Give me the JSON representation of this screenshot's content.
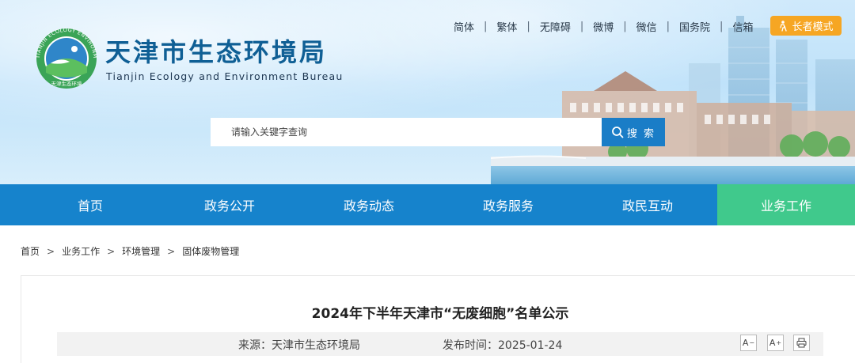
{
  "header": {
    "title": "天津市生态环境局",
    "subtitle": "Tianjin Ecology and Environment Bureau",
    "logo_ring_text": "TIANJIN ECOLOGY ENVIRONMENT",
    "logo_bottom_text": "天津生态环境",
    "top_links": [
      "简体",
      "繁体",
      "无障碍",
      "微博",
      "微信",
      "国务院",
      "信箱"
    ],
    "elder_mode": "长者模式",
    "search": {
      "placeholder": "请输入关键字查询",
      "button": "搜 索"
    }
  },
  "nav": [
    {
      "label": "首页",
      "active": false
    },
    {
      "label": "政务公开",
      "active": false
    },
    {
      "label": "政务动态",
      "active": false
    },
    {
      "label": "政务服务",
      "active": false
    },
    {
      "label": "政民互动",
      "active": false
    },
    {
      "label": "业务工作",
      "active": true
    }
  ],
  "breadcrumb": [
    "首页",
    "业务工作",
    "环境管理",
    "固体废物管理"
  ],
  "breadcrumb_separator": ">",
  "article": {
    "title": "2024年下半年天津市“无废细胞”名单公示",
    "source": "来源：天津市生态环境局",
    "date": "发布时间：2025-01-24",
    "font_decrease": "A",
    "font_increase": "A"
  },
  "colors": {
    "primary": "#1683cc",
    "active_nav": "#40c98c",
    "title_blue": "#0f5f95",
    "elder_orange": "#f6a623"
  }
}
